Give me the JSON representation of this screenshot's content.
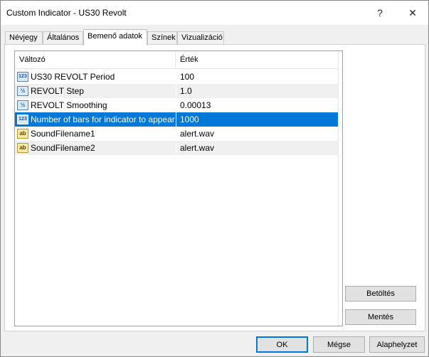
{
  "window": {
    "title": "Custom Indicator - US30 Revolt",
    "help_glyph": "?",
    "close_glyph": "✕"
  },
  "tabs": [
    {
      "label": "Névjegy",
      "active": false
    },
    {
      "label": "Általános",
      "active": false
    },
    {
      "label": "Bemenő adatok",
      "active": true
    },
    {
      "label": "Színek",
      "active": false
    },
    {
      "label": "Vizualizáció",
      "active": false
    }
  ],
  "grid": {
    "columns": [
      "Változó",
      "Érték"
    ],
    "rows": [
      {
        "icon": "int-icon",
        "icon_text": "123",
        "name": "US30 REVOLT Period",
        "value": "100",
        "selected": false
      },
      {
        "icon": "double-icon",
        "icon_text": "½",
        "name": "REVOLT Step",
        "value": "1.0",
        "selected": false
      },
      {
        "icon": "double-icon",
        "icon_text": "½",
        "name": "REVOLT Smoothing",
        "value": "0.00013",
        "selected": false
      },
      {
        "icon": "int-icon",
        "icon_text": "123",
        "name": "Number of bars for indicator to appear",
        "value": "1000",
        "selected": true
      },
      {
        "icon": "string-icon",
        "icon_text": "ab",
        "name": "SoundFilename1",
        "value": "alert.wav",
        "selected": false
      },
      {
        "icon": "string-icon",
        "icon_text": "ab",
        "name": "SoundFilename2",
        "value": "alert.wav",
        "selected": false
      }
    ]
  },
  "side_buttons": {
    "load": "Betöltés",
    "save": "Mentés"
  },
  "bottom_buttons": {
    "ok": "OK",
    "cancel": "Mégse",
    "reset": "Alaphelyzet"
  },
  "colors": {
    "selection": "#0078d7",
    "alt_row": "#f0f0f0",
    "dialog_bg": "#f0f0f0"
  }
}
